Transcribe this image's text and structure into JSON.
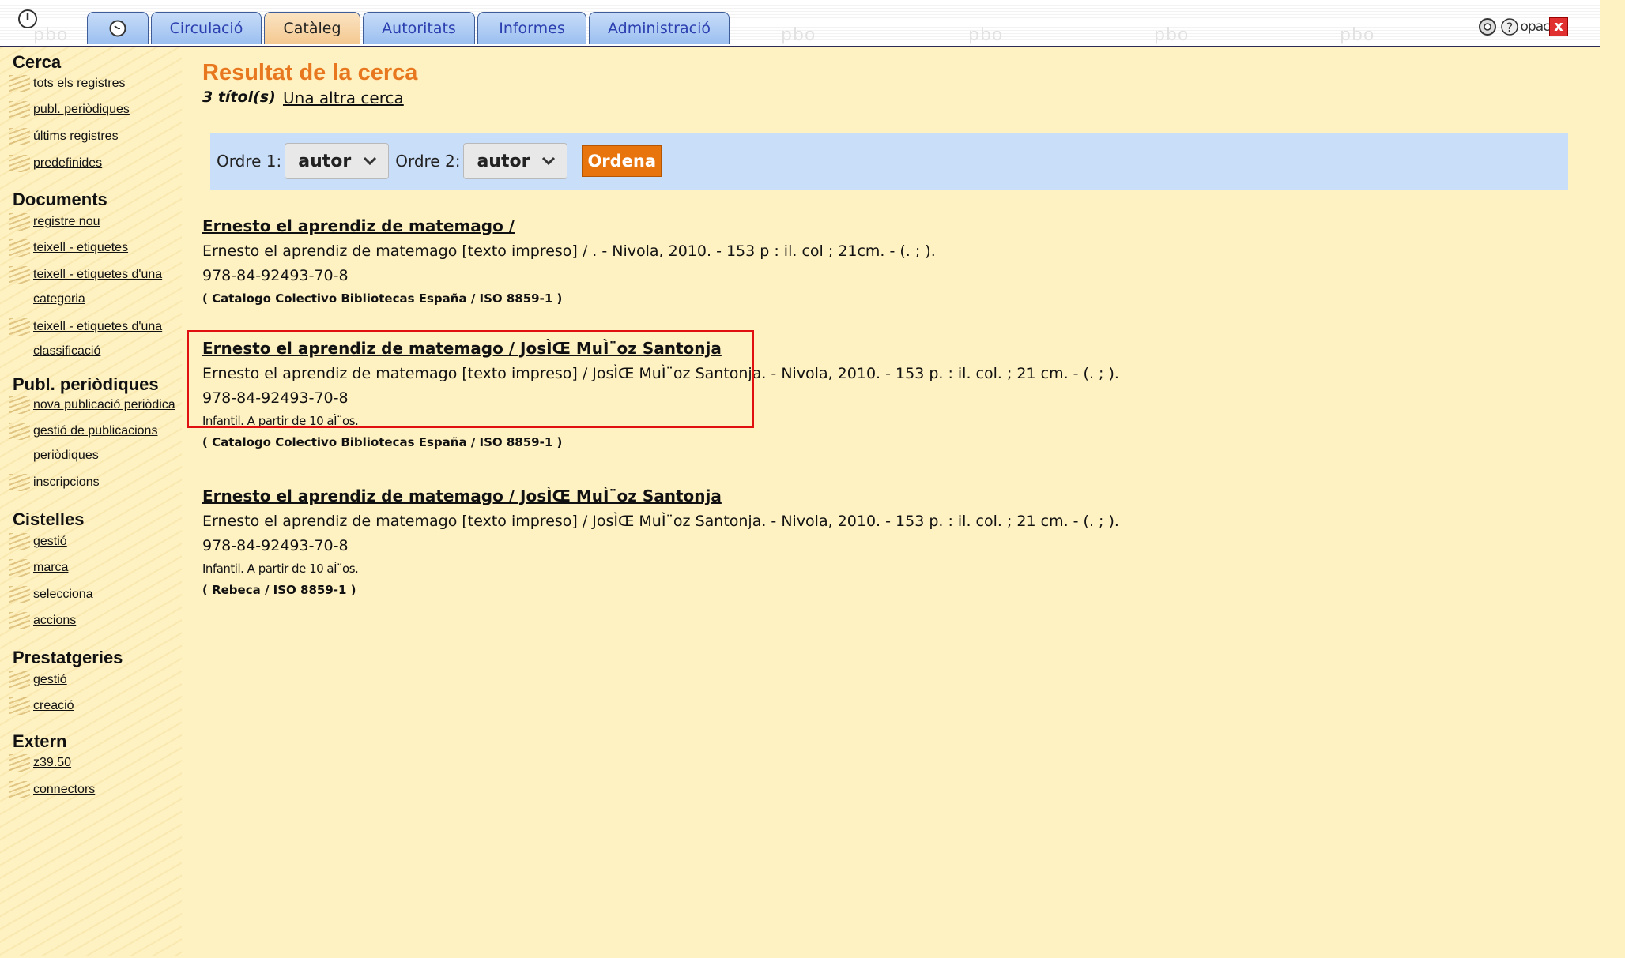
{
  "topbar": {
    "watermark": "pbo",
    "tabs": [
      {
        "label": "Circulació"
      },
      {
        "label": "Catàleg"
      },
      {
        "label": "Autoritats"
      },
      {
        "label": "Informes"
      },
      {
        "label": "Administració"
      }
    ],
    "opac_label": "opac",
    "close_label": "x"
  },
  "sidebar": {
    "sections": [
      {
        "title": "Cerca",
        "links": [
          "tots els registres",
          "publ. periòdiques",
          "últims registres",
          "predefinides"
        ]
      },
      {
        "title": "Documents",
        "links": [
          "registre nou",
          "teixell - etiquetes",
          "teixell - etiquetes d'una categoria",
          "teixell - etiquetes d'una classificació"
        ]
      },
      {
        "title": "Publ. periòdiques",
        "links": [
          "nova publicació periòdica",
          "gestió de publicacions periòdiques",
          "inscripcions"
        ]
      },
      {
        "title": "Cistelles",
        "links": [
          "gestió",
          "marca",
          "selecciona",
          "accions"
        ]
      },
      {
        "title": "Prestatgeries",
        "links": [
          "gestió",
          "creació"
        ]
      },
      {
        "title": "Extern",
        "links": [
          "z39.50",
          "connectors"
        ]
      }
    ]
  },
  "main": {
    "title": "Resultat de la cerca",
    "count": "3 títol(s)",
    "another_search": "Una altra cerca",
    "order1_label": "Ordre 1:",
    "order1_value": "autor",
    "order2_label": "Ordre 2:",
    "order2_value": "autor",
    "order_button": "Ordena",
    "results": [
      {
        "title": "Ernesto el aprendiz de matemago /",
        "desc": "Ernesto el aprendiz de matemago [texto impreso] / . - Nivola, 2010. - 153 p : il. col ; 21cm. - (. ; ).",
        "isbn": "978-84-92493-70-8",
        "note": "",
        "source": "( Catalogo Colectivo Bibliotecas España / ISO 8859-1 )"
      },
      {
        "title": "Ernesto el aprendiz de matemago / JosÌŒ MuÌ¨oz Santonja",
        "desc": "Ernesto el aprendiz de matemago [texto impreso] / JosÌŒ MuÌ¨oz Santonja. - Nivola, 2010. - 153 p. : il. col. ; 21 cm. - (. ; ).",
        "isbn": "978-84-92493-70-8",
        "note": "Infantil. A partir de 10 aÌ¨os.",
        "source": "( Catalogo Colectivo Bibliotecas España / ISO 8859-1 )"
      },
      {
        "title": "Ernesto el aprendiz de matemago / JosÌŒ MuÌ¨oz Santonja",
        "desc": "Ernesto el aprendiz de matemago [texto impreso] / JosÌŒ MuÌ¨oz Santonja. - Nivola, 2010. - 153 p. : il. col. ; 21 cm. - (. ; ).",
        "isbn": "978-84-92493-70-8",
        "note": "Infantil. A partir de 10 aÌ¨os.",
        "source": "( Rebeca / ISO 8859-1 )"
      }
    ]
  },
  "colors": {
    "background": "#fff2c2",
    "title": "#e87820",
    "order_bar": "#c9def9",
    "button": "#e8740e",
    "highlight": "#e01010"
  }
}
